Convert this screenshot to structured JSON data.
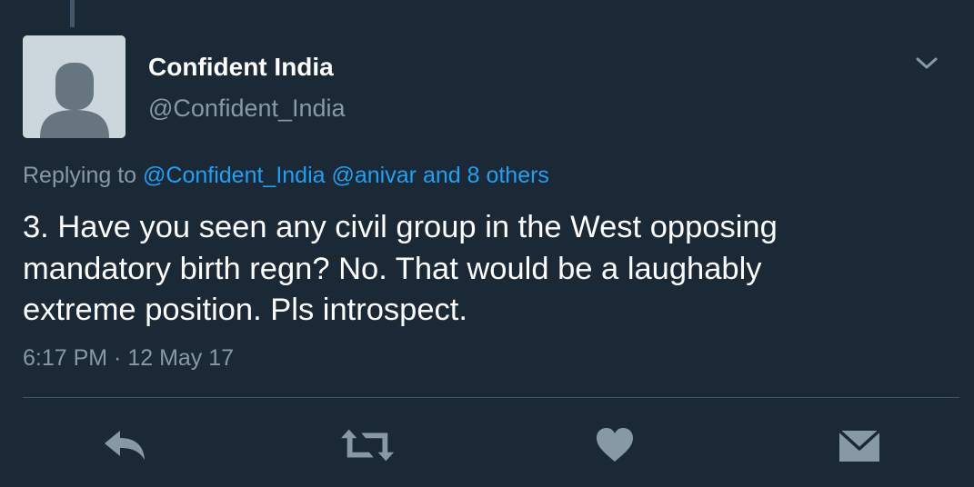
{
  "tweet": {
    "display_name": "Confident India",
    "handle": "@Confident_India",
    "replying_prefix": "Replying to",
    "replying_mention_1": "@Confident_India",
    "replying_mention_2": "@anivar",
    "replying_others": "and 8 others",
    "text_lines": [
      "3. Have you seen any civil group in the West opposing",
      "mandatory birth regn? No. That would be a laughably",
      "extreme position. Pls introspect."
    ],
    "timestamp": "6:17 PM · 12 May 17"
  },
  "icons": {
    "avatar": "default-profile-silhouette",
    "caret": "chevron-down-icon",
    "actions": [
      "reply-icon",
      "retweet-icon",
      "heart-icon",
      "mail-icon"
    ]
  },
  "colors": {
    "background": "#1b2836",
    "link": "#1da1f2",
    "muted": "#8899a6",
    "icon": "#8899a6"
  }
}
